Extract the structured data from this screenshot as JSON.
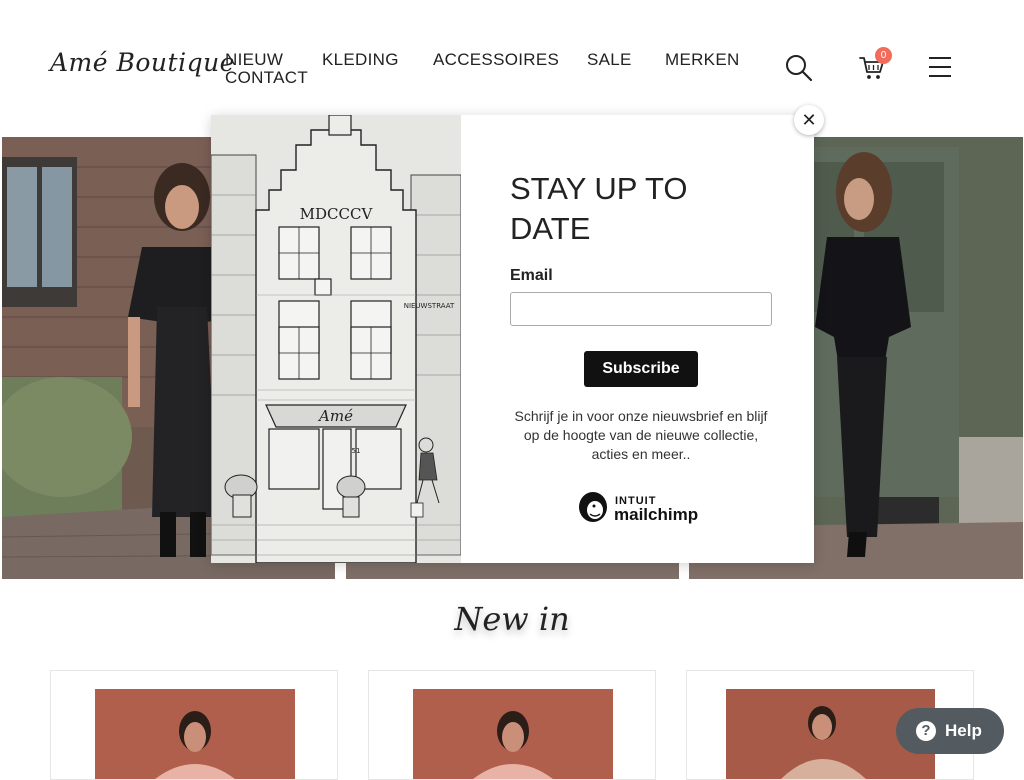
{
  "header": {
    "logo": "Amé Boutique",
    "nav": [
      "NIEUW",
      "KLEDING",
      "ACCESSOIRES",
      "SALE",
      "MERKEN",
      "CONTACT"
    ],
    "cart_count": "0",
    "icons": [
      "search-icon",
      "cart-icon",
      "menu-icon"
    ]
  },
  "popup": {
    "title": "STAY UP TO DATE",
    "email_label": "Email",
    "email_value": "",
    "subscribe_label": "Subscribe",
    "description": "Schrijf je in voor onze nieuwsbrief en blijf op de hoogte van de nieuwe collectie, acties en meer..",
    "mailchimp_brand": "INTUIT",
    "mailchimp_product": "mailchimp",
    "close_symbol": "✕",
    "art": {
      "facade_year": "MDCCCV",
      "street_sign": "NIEUWSTRAAT",
      "shop_sign": "Amé",
      "house_number": "51"
    }
  },
  "section": {
    "new_in_title": "New in"
  },
  "help": {
    "label": "Help",
    "icon_symbol": "?"
  },
  "colors": {
    "accent_badge": "#f26b5b",
    "help_bg": "#535a60",
    "button_dark": "#111111",
    "product_bg": "#b05f4c"
  }
}
